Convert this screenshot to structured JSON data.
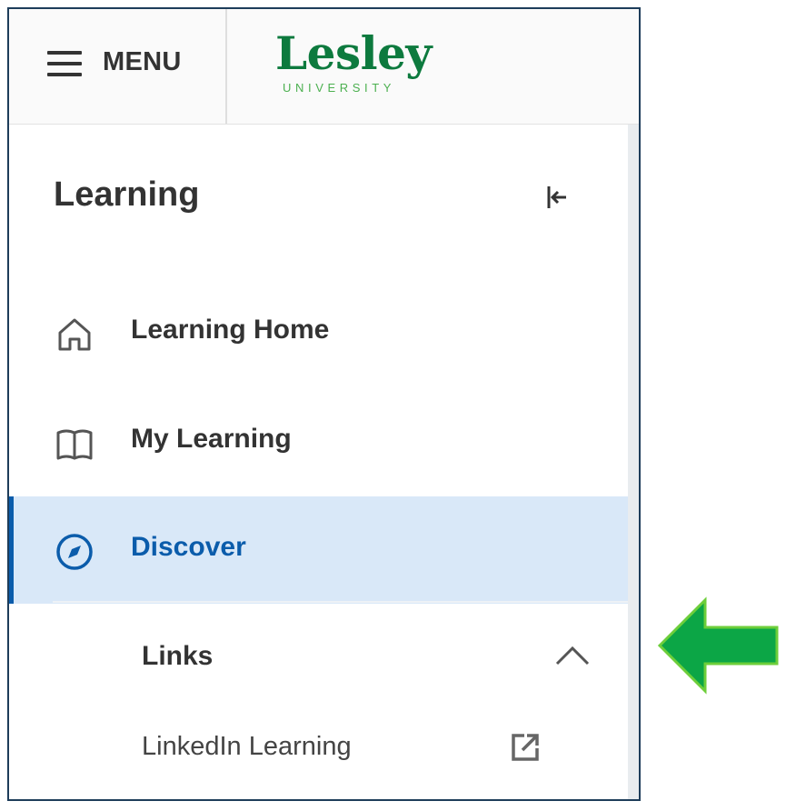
{
  "header": {
    "menu_label": "MENU",
    "logo_name": "Lesley",
    "logo_subtitle": "UNIVERSITY"
  },
  "sidebar": {
    "title": "Learning",
    "items": [
      {
        "label": "Learning Home",
        "icon": "home-icon"
      },
      {
        "label": "My Learning",
        "icon": "book-icon"
      },
      {
        "label": "Discover",
        "icon": "compass-icon",
        "active": true
      }
    ],
    "links_section": {
      "label": "Links",
      "expanded": true,
      "items": [
        {
          "label": "LinkedIn Learning",
          "icon": "external-link-icon"
        }
      ]
    }
  },
  "colors": {
    "accent": "#0b5cab",
    "active_bg": "#d9e8f8",
    "brand_green": "#0d7a3e",
    "arrow_green": "#0ca646"
  }
}
